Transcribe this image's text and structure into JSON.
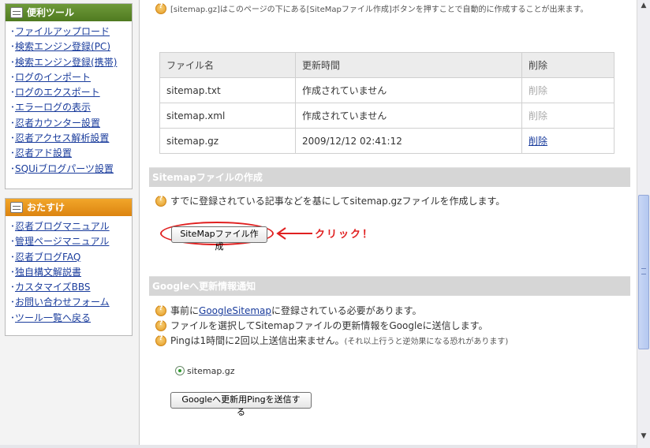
{
  "sidebar": {
    "tools": {
      "title": "便利ツール",
      "items": [
        "ファイルアップロード",
        "検索エンジン登録(PC)",
        "検索エンジン登録(携帯)",
        "ログのインポート",
        "ログのエクスポート",
        "エラーログの表示",
        "忍者カウンター設置",
        "忍者アクセス解析設置",
        "忍者アド設置",
        "SQUiブログパーツ設置"
      ]
    },
    "help": {
      "title": "おたすけ",
      "items": [
        "忍者ブログマニュアル",
        "管理ページマニュアル",
        "忍者ブログFAQ",
        "独自構文解説書",
        "カスタマイズBBS",
        "お問い合わせフォーム",
        "ツール一覧へ戻る"
      ]
    }
  },
  "main": {
    "top_note": "[sitemap.gz]はこのページの下にある[SiteMapファイル作成]ボタンを押すことで自動的に作成することが出来ます。",
    "table": {
      "headers": [
        "ファイル名",
        "更新時間",
        "削除"
      ],
      "rows": [
        {
          "name": "sitemap.txt",
          "updated": "作成されていません",
          "delete": "削除",
          "delete_enabled": false
        },
        {
          "name": "sitemap.xml",
          "updated": "作成されていません",
          "delete": "削除",
          "delete_enabled": false
        },
        {
          "name": "sitemap.gz",
          "updated": "2009/12/12 02:41:12",
          "delete": "削除",
          "delete_enabled": true
        }
      ]
    },
    "sitemap_section": {
      "title": "Sitemapファイルの作成",
      "description": "すでに登録されている記事などを基にしてsitemap.gzファイルを作成します。",
      "button": "SiteMapファイル作成",
      "annotation": "クリック！"
    },
    "google_section": {
      "title": "Googleへ更新情報通知",
      "line1_prefix": "事前に",
      "line1_link": "GoogleSitemap",
      "line1_suffix": "に登録されている必要があります。",
      "line2": "ファイルを選択してSitemapファイルの更新情報をGoogleに送信します。",
      "line3_main": "Pingは1時間に2回以上送信出来ません。",
      "line3_small": "(それ以上行うと逆効果になる恐れがあります)",
      "radio_label": "sitemap.gz",
      "button": "Googleへ更新用Pingを送信する"
    }
  },
  "colors": {
    "tools_header": "#5e8a2c",
    "help_header": "#e8951c",
    "section_bar": "#d6d6d6",
    "annotation": "#e02020",
    "link": "#1a3c9c"
  }
}
